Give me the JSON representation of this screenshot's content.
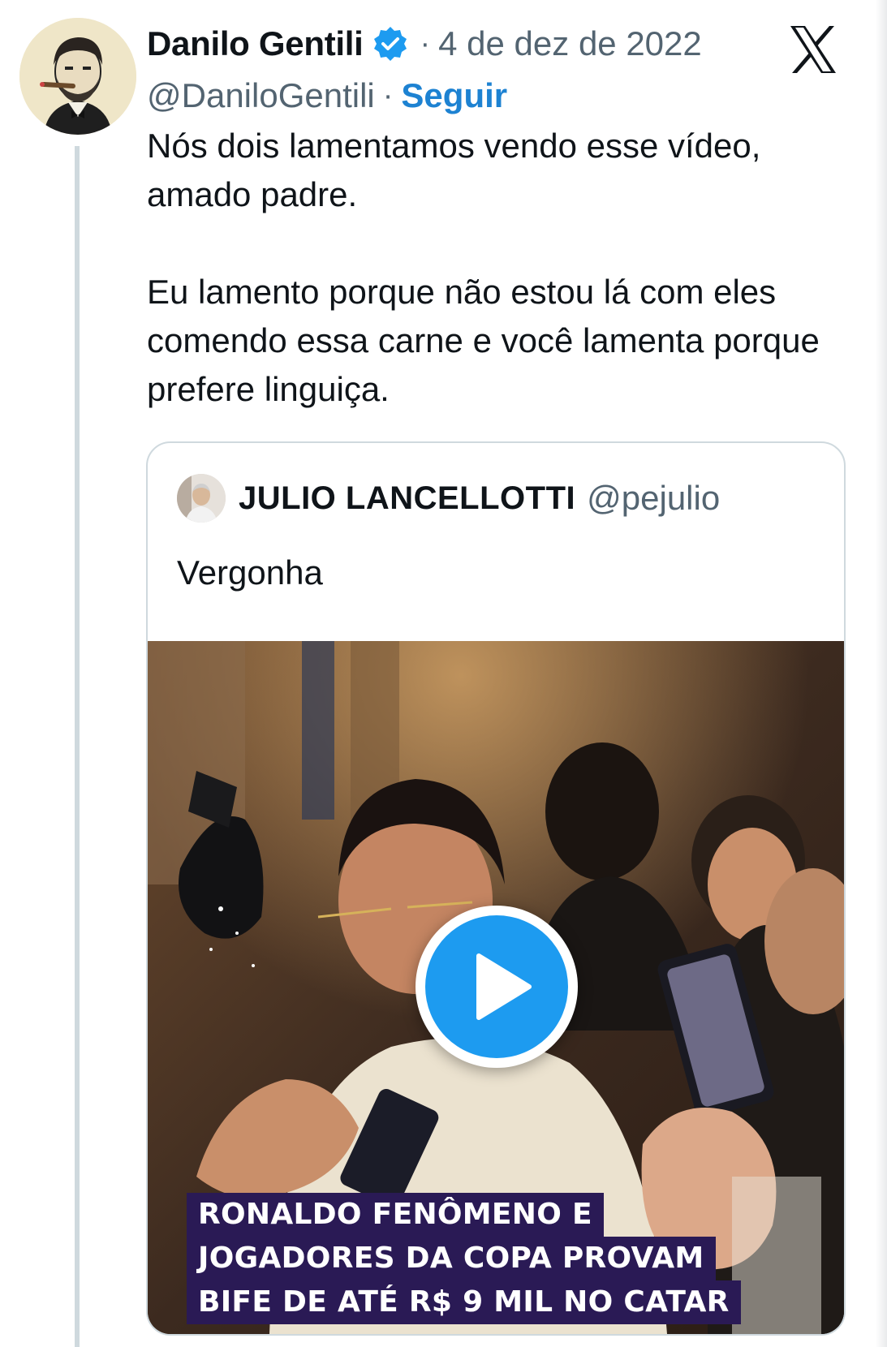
{
  "tweet": {
    "author_name": "Danilo Gentili",
    "author_handle": "@DaniloGentili",
    "separator": "·",
    "date": "4 de dez de 2022",
    "follow_label": "Seguir",
    "verified_icon": "verified-badge-icon",
    "platform_icon": "x-logo-icon",
    "text_paragraphs": [
      "Nós dois lamentamos vendo esse vídeo, amado padre.",
      "Eu lamento porque não estou lá com eles comendo essa carne e você lamenta porque prefere linguiça."
    ]
  },
  "quoted_tweet": {
    "author_name": "JULIO LANCELLOTTI",
    "author_handle": "@pejulio",
    "text": "Vergonha",
    "video": {
      "play_icon": "play-icon",
      "caption_lines": [
        "RONALDO FENÔMENO E",
        "JOGADORES DA COPA PROVAM",
        "BIFE DE ATÉ R$ 9 MIL NO CATAR"
      ]
    }
  },
  "colors": {
    "accent_blue": "#1d9bf0",
    "link_blue": "#1d82d2",
    "secondary_text": "#536471",
    "border": "#cfd9de",
    "caption_background": "#2a1a55"
  }
}
